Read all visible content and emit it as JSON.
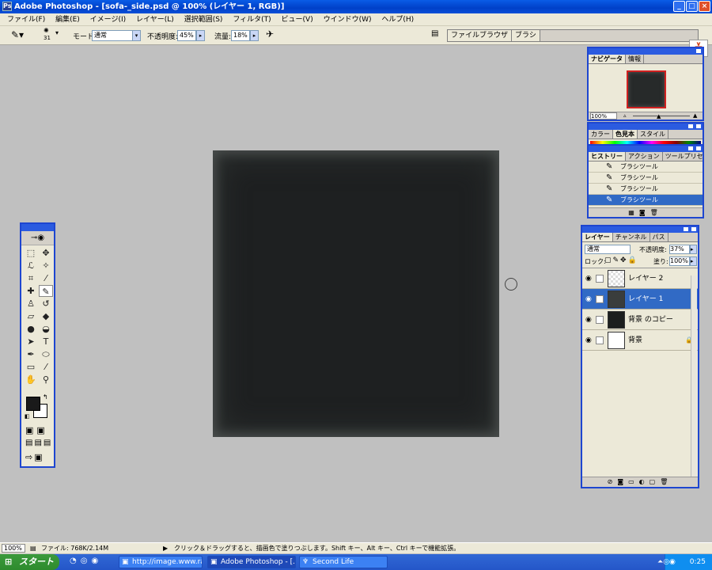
{
  "window": {
    "title": "Adobe Photoshop - [sofa-_side.psd @ 100% (レイヤー 1, RGB)]",
    "app_icon": "Ps",
    "min": "_",
    "max": "□",
    "close": "×"
  },
  "menu": [
    "ファイル(F)",
    "編集(E)",
    "イメージ(I)",
    "レイヤー(L)",
    "選択範囲(S)",
    "フィルタ(T)",
    "ビュー(V)",
    "ウインドウ(W)",
    "ヘルプ(H)"
  ],
  "options": {
    "brush_size": "31",
    "mode_label": "モード:",
    "mode_value": "通常",
    "opacity_label": "不透明度:",
    "opacity_value": "45%",
    "flow_label": "流量:",
    "flow_value": "18%"
  },
  "well": {
    "tabs": [
      "ファイルブラウザ",
      "ブラシ"
    ]
  },
  "navigator": {
    "tabs": [
      "ナビゲータ",
      "情報"
    ],
    "zoom": "100%"
  },
  "color_palette": {
    "tabs": [
      "カラー",
      "色見本",
      "スタイル"
    ]
  },
  "history": {
    "tabs": [
      "ヒストリー",
      "アクション",
      "ツールプリセット"
    ],
    "items": [
      "ブラシツール",
      "ブラシツール",
      "ブラシツール",
      "ブラシツール"
    ]
  },
  "layers": {
    "tabs": [
      "レイヤー",
      "チャンネル",
      "パス"
    ],
    "blend": "通常",
    "opacity_label": "不透明度:",
    "opacity_value": "37%",
    "lock_label": "ロック:",
    "fill_label": "塗り:",
    "fill_value": "100%",
    "items": [
      {
        "name": "レイヤー 2",
        "thumb_color": "#d8d8d8"
      },
      {
        "name": "レイヤー 1",
        "thumb_color": "#3a3d3c"
      },
      {
        "name": "背景 のコピー",
        "thumb_color": "#1c1e1e"
      },
      {
        "name": "背景",
        "thumb_color": "#ffffff"
      }
    ]
  },
  "status": {
    "zoom": "100%",
    "file": "ファイル: 768K/2.14M",
    "hint": "クリック＆ドラッグすると、描画色で塗りつぶします。Shift キー、Alt キー、Ctrl キーで機能拡張。"
  },
  "taskbar": {
    "start": "スタート",
    "tasks": [
      "http://image.www.rak...",
      "Adobe Photoshop - [...",
      "Second Life"
    ],
    "clock": "0:25"
  },
  "colors": {
    "accent": "#1e46d0",
    "selection": "#316ac5",
    "canvas": "#1e2021"
  }
}
